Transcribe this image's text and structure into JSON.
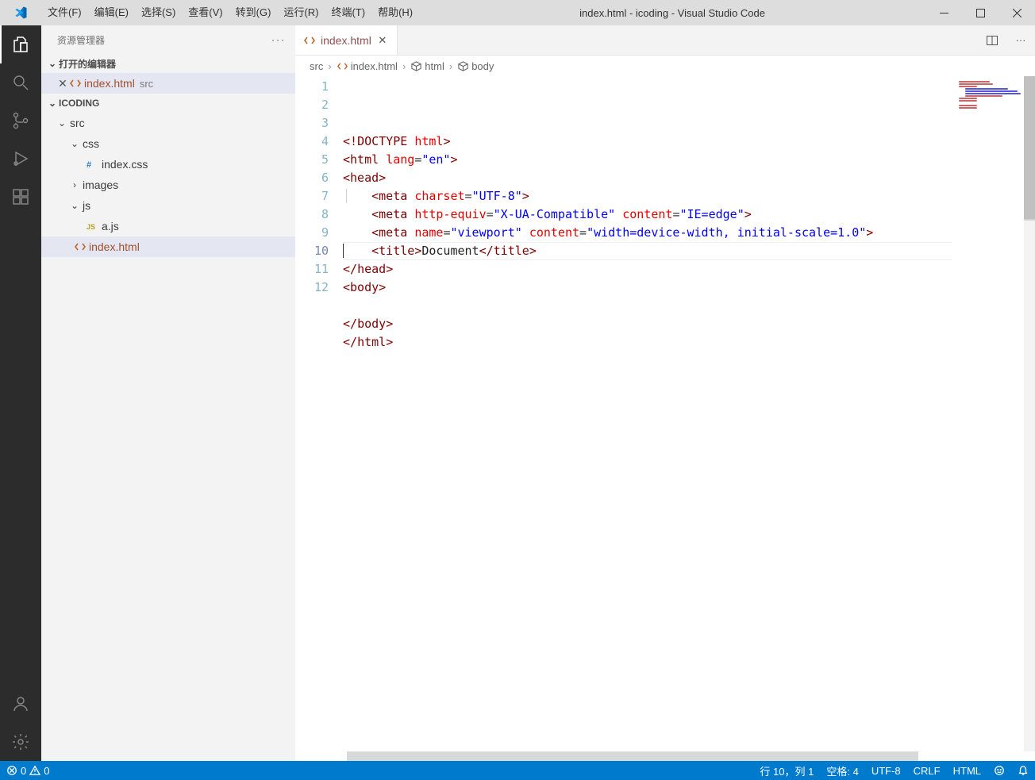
{
  "title": "index.html - icoding - Visual Studio Code",
  "menu": {
    "file": "文件(F)",
    "edit": "编辑(E)",
    "select": "选择(S)",
    "view": "查看(V)",
    "goto": "转到(G)",
    "run": "运行(R)",
    "terminal": "终端(T)",
    "help": "帮助(H)"
  },
  "sidebar": {
    "title": "资源管理器",
    "openEditors": "打开的编辑器",
    "project": "ICODING",
    "openFile": {
      "name": "index.html",
      "hint": "src"
    },
    "tree": {
      "src": "src",
      "css": "css",
      "indexcss": "index.css",
      "images": "images",
      "js": "js",
      "ajs": "a.js",
      "indexhtml": "index.html"
    }
  },
  "tab": {
    "name": "index.html"
  },
  "breadcrumb": {
    "src": "src",
    "file": "index.html",
    "html": "html",
    "body": "body"
  },
  "lines": [
    "1",
    "2",
    "3",
    "4",
    "5",
    "6",
    "7",
    "8",
    "9",
    "10",
    "11",
    "12"
  ],
  "status": {
    "errors": "0",
    "warnings": "0",
    "pos": "行 10，列 1",
    "spaces": "空格: 4",
    "enc": "UTF-8",
    "eol": "CRLF",
    "lang": "HTML"
  }
}
